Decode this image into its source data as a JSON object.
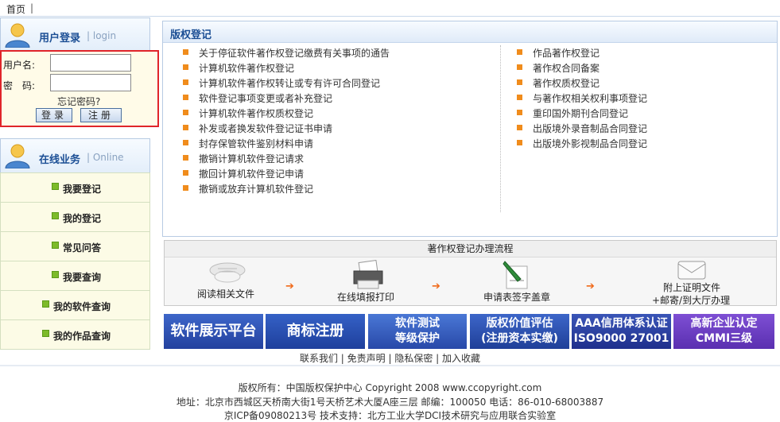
{
  "topnav": {
    "home": "首页",
    "divider": "|"
  },
  "login": {
    "title": "用户登录",
    "title_en": "| login",
    "username_label": "用户名:",
    "password_label": "密　码:",
    "username_value": "",
    "password_value": "",
    "forgot": "忘记密码?",
    "login_button": "登录",
    "register_button": "注册"
  },
  "online": {
    "title": "在线业务",
    "title_en": "| Online",
    "items": [
      "我要登记",
      "我的登记",
      "常见问答",
      "我要查询",
      "我的软件查询",
      "我的作品查询"
    ]
  },
  "copyright_reg": {
    "title": "版权登记",
    "left_links": [
      "关于停征软件著作权登记缴费有关事项的通告",
      "计算机软件著作权登记",
      "计算机软件著作权转让或专有许可合同登记",
      "软件登记事项变更或者补充登记",
      "计算机软件著作权质权登记",
      "补发或者换发软件登记证书申请",
      "封存保管软件鉴别材料申请",
      "撤销计算机软件登记请求",
      "撤回计算机软件登记申请",
      "撤销或放弃计算机软件登记"
    ],
    "right_links": [
      "作品著作权登记",
      "著作权合同备案",
      "著作权质权登记",
      "与著作权相关权利事项登记",
      "重印国外期刊合同登记",
      "出版境外录音制品合同登记",
      "出版境外影视制品合同登记"
    ]
  },
  "process": {
    "title": "著作权登记办理流程",
    "steps": [
      {
        "label": "阅读相关文件",
        "icon": "document-stack-icon"
      },
      {
        "label": "在线填报打印",
        "icon": "printer-icon"
      },
      {
        "label": "申请表签字盖章",
        "icon": "pen-sign-icon"
      },
      {
        "label1": "附上证明文件",
        "label2": "+邮寄/到大厅办理",
        "icon": "envelope-icon"
      }
    ],
    "arrow": "➔"
  },
  "banners": [
    {
      "l1": "软件展示平台",
      "color": "#2c4fb6"
    },
    {
      "l1": "商标注册",
      "color": "#1f49b0"
    },
    {
      "l1": "软件测试",
      "l2": "等级保护",
      "color": "#3360c4"
    },
    {
      "l1": "版权价值评估",
      "l2": "(注册资本实缴)",
      "color": "#274aa8"
    },
    {
      "l1": "AAA信用体系认证",
      "l2": "ISO9000 27001",
      "color": "#2a3fa0"
    },
    {
      "l1": "高新企业认定",
      "l2": "CMMI三级",
      "color": "#6a3cc0"
    }
  ],
  "footer": {
    "links": "联系我们 | 免责声明 | 隐私保密 | 加入收藏",
    "line1": "版权所有：中国版权保护中心 Copyright 2008 www.ccopyright.com",
    "line2": "地址：北京市西城区天桥南大街1号天桥艺术大厦A座三层 邮编：100050 电话：86-010-68003887",
    "line3": "京ICP备09080213号 技术支持：北方工业大学DCI技术研究与应用联合实验室"
  }
}
